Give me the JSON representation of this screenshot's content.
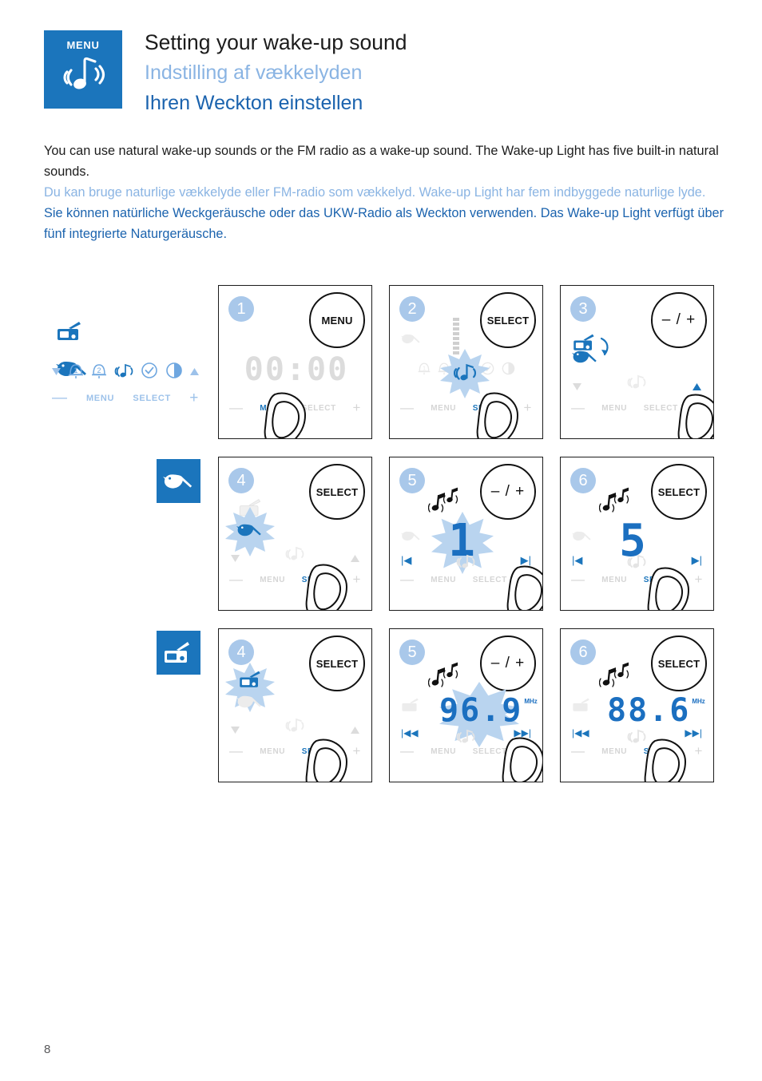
{
  "header": {
    "badge_label": "MENU",
    "badge_icon": "wake-up-sound-note-icon",
    "title_en": "Setting your wake-up sound",
    "title_da": "Indstilling af vækkelyden",
    "title_de": "Ihren Weckton einstellen"
  },
  "intro": {
    "en": "You can use natural wake-up sounds or the FM radio as a wake-up sound. The Wake-up Light has five built-in natural sounds.",
    "da": "Du kan bruge naturlige vækkelyde eller FM-radio som vækkelyd. Wake-up Light har fem indbyggede naturlige lyde.",
    "de": "Sie können natürliche Weckgeräusche oder das UKW-Radio als Weckton verwenden. Das Wake-up Light verfügt über fünf integrierte Naturgeräusche."
  },
  "legend": {
    "radio_icon": "radio-icon",
    "bird_icon": "bird-icon",
    "icons": [
      "alarm-1-icon",
      "alarm-2-icon",
      "wake-up-sound-icon",
      "clock-icon",
      "brightness-icon"
    ],
    "down_arrow": "▼",
    "up_arrow": "▲",
    "minus": "—",
    "menu_label": "MENU",
    "select_label": "SELECT",
    "plus": "+"
  },
  "row_badges": {
    "row2": "bird-icon",
    "row3": "radio-icon"
  },
  "controls": {
    "minus": "—",
    "plus": "+",
    "menu": "MENU",
    "select": "SELECT",
    "down_arrow": "▼",
    "up_arrow": "▲",
    "prev": "|◀",
    "next": "▶|",
    "prev_fast": "|◀◀",
    "next_fast": "▶▶|"
  },
  "panels": [
    {
      "step": "1",
      "button": "MENU",
      "button_type": "text",
      "display": "00:00",
      "display_state": "dim",
      "lit_control": "MENU",
      "row": 1,
      "col": 1
    },
    {
      "step": "2",
      "button": "SELECT",
      "button_type": "text",
      "highlight_icon": "wake-up-sound-icon",
      "lit_control": "SELECT",
      "row": 1,
      "col": 2
    },
    {
      "step": "3",
      "button": "– / +",
      "button_type": "plusminus",
      "shown_icons": [
        "radio-icon",
        "bird-icon"
      ],
      "toggle_arrow": "curved-arrow-icon",
      "lit_control": "+",
      "lit_arrow": "up",
      "row": 1,
      "col": 3
    },
    {
      "step": "4",
      "button": "SELECT",
      "button_type": "text",
      "highlight_icon": "bird-icon",
      "lit_control": "SELECT",
      "row": 2,
      "col": 1
    },
    {
      "step": "5",
      "button": "– / +",
      "button_type": "plusminus",
      "display": "1",
      "display_state": "blinking",
      "notes_icon": "music-notes-icon",
      "lit_control": "+",
      "row": 2,
      "col": 2
    },
    {
      "step": "6",
      "button": "SELECT",
      "button_type": "text",
      "display": "5",
      "display_state": "lit",
      "notes_icon": "music-notes-icon",
      "lit_control": "SELECT",
      "row": 2,
      "col": 3
    },
    {
      "step": "4",
      "button": "SELECT",
      "button_type": "text",
      "highlight_icon": "radio-icon",
      "lit_control": "SELECT",
      "row": 3,
      "col": 1
    },
    {
      "step": "5",
      "button": "– / +",
      "button_type": "plusminus",
      "display": "96.9",
      "display_unit": "MHz",
      "display_state": "blinking",
      "notes_icon": "music-notes-icon",
      "lit_control": "+",
      "row": 3,
      "col": 2
    },
    {
      "step": "6",
      "button": "SELECT",
      "button_type": "text",
      "display": "88.6",
      "display_unit": "MHz",
      "display_state": "lit",
      "notes_icon": "music-notes-icon",
      "lit_control": "SELECT",
      "row": 3,
      "col": 3
    }
  ],
  "page_number": "8",
  "colors": {
    "brand_blue": "#1b75bc",
    "light_blue": "#8ab4e3",
    "de_blue": "#1b63ae",
    "bubble_blue": "#a9c8ea",
    "burst_blue": "#b9d4ef",
    "dim_gray": "#d5d5d5"
  }
}
